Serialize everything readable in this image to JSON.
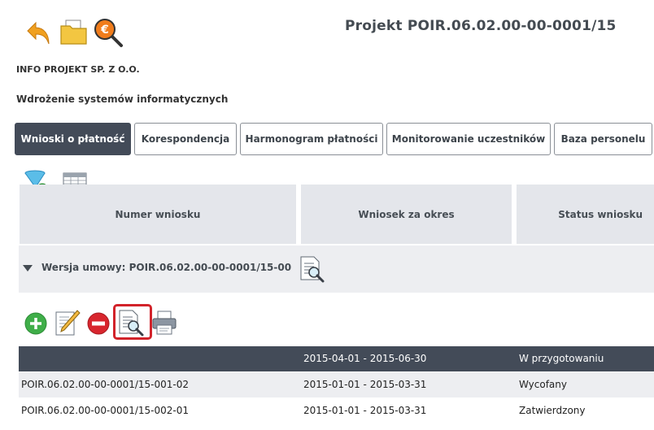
{
  "toolbar": {
    "back_icon": "back-arrow-icon",
    "folder_icon": "folder-icon",
    "finance_search_icon": "euro-search-icon"
  },
  "header": {
    "project_title": "Projekt POIR.06.02.00-00-0001/15",
    "company": "INFO PROJEKT SP. Z O.O.",
    "project_name": "Wdrożenie systemów informatycznych"
  },
  "tabs": [
    {
      "label": "Wnioski o płatność",
      "active": true
    },
    {
      "label": "Korespondencja",
      "active": false
    },
    {
      "label": "Harmonogram płatności",
      "active": false
    },
    {
      "label": "Monitorowanie uczestników",
      "active": false
    },
    {
      "label": "Baza personelu",
      "active": false
    }
  ],
  "filter_icons": [
    "filter-add-icon",
    "table-icon"
  ],
  "table": {
    "headers": [
      "Numer wniosku",
      "Wniosek za okres",
      "Status wniosku"
    ],
    "group_label": "Wersja umowy: POIR.06.02.00-00-0001/15-00",
    "actions": [
      "add-icon",
      "edit-icon",
      "delete-icon",
      "preview-icon",
      "print-icon"
    ],
    "rows": [
      {
        "number": "",
        "period": "2015-04-01 - 2015-06-30",
        "status": "W przygotowaniu",
        "selected": true
      },
      {
        "number": "POIR.06.02.00-00-0001/15-001-02",
        "period": "2015-01-01 - 2015-03-31",
        "status": "Wycofany",
        "selected": false
      },
      {
        "number": "POIR.06.02.00-00-0001/15-002-01",
        "period": "2015-01-01 - 2015-03-31",
        "status": "Zatwierdzony",
        "selected": false
      }
    ]
  },
  "colors": {
    "active_tab": "#434b58",
    "header_bg": "#e4e6eb",
    "highlight": "#d2232a"
  }
}
